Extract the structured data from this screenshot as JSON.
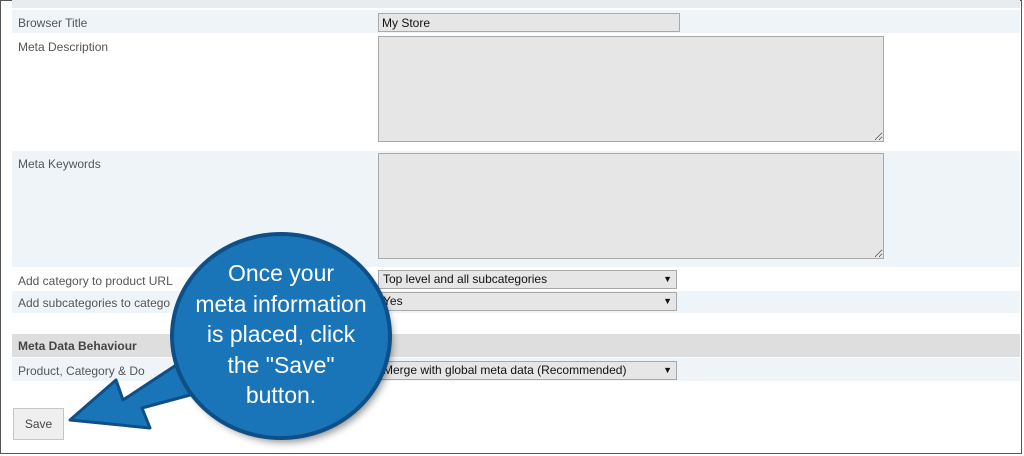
{
  "form": {
    "browser_title": {
      "label": "Browser Title",
      "value": "My Store"
    },
    "meta_description": {
      "label": "Meta Description",
      "value": ""
    },
    "meta_keywords": {
      "label": "Meta Keywords",
      "value": ""
    },
    "add_category_url": {
      "label": "Add category to product URL",
      "selected": "Top level and all subcategories"
    },
    "add_subcategories": {
      "label": "Add subcategories to catego",
      "selected": "Yes"
    },
    "behaviour_section": {
      "title": "Meta Data Behaviour"
    },
    "product_category_doc": {
      "label": "Product, Category & Do",
      "selected": "Merge with global meta data (Recommended)"
    }
  },
  "save_label": "Save",
  "callout": {
    "line1": "Once your",
    "line2": "meta information",
    "line3": "is placed, click",
    "line4": "the \"Save\"",
    "line5": "button."
  },
  "colors": {
    "callout_fill": "#1a75b8",
    "callout_border": "#0d4f86",
    "row_alt": "#eef4f8",
    "section_bg": "#dedede"
  },
  "icons": {
    "select_arrow": "triangle-down-icon",
    "callout_arrow": "arrow-pointer-icon"
  }
}
